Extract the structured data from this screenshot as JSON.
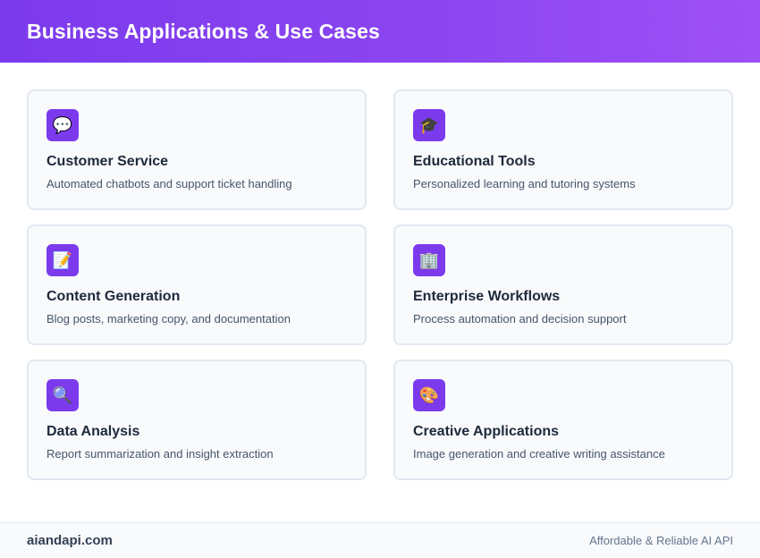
{
  "header": {
    "title": "Business Applications & Use Cases"
  },
  "cards": [
    {
      "icon": "💬",
      "icon_name": "speech-bubble-icon",
      "title": "Customer Service",
      "description": "Automated chatbots and support ticket handling"
    },
    {
      "icon": "🎓",
      "icon_name": "graduation-cap-icon",
      "title": "Educational Tools",
      "description": "Personalized learning and tutoring systems"
    },
    {
      "icon": "📝",
      "icon_name": "memo-icon",
      "title": "Content Generation",
      "description": "Blog posts, marketing copy, and documentation"
    },
    {
      "icon": "🏢",
      "icon_name": "office-building-icon",
      "title": "Enterprise Workflows",
      "description": "Process automation and decision support"
    },
    {
      "icon": "🔍",
      "icon_name": "magnifying-glass-icon",
      "title": "Data Analysis",
      "description": "Report summarization and insight extraction"
    },
    {
      "icon": "🎨",
      "icon_name": "artist-palette-icon",
      "title": "Creative Applications",
      "description": "Image generation and creative writing assistance"
    }
  ],
  "footer": {
    "brand": "aiandapi.com",
    "tagline": "Affordable & Reliable AI API"
  },
  "colors": {
    "accent": "#7c3aed",
    "header_gradient_end": "#9d50f5",
    "card_background": "#f8fafc",
    "card_border": "#e2e8f0"
  }
}
